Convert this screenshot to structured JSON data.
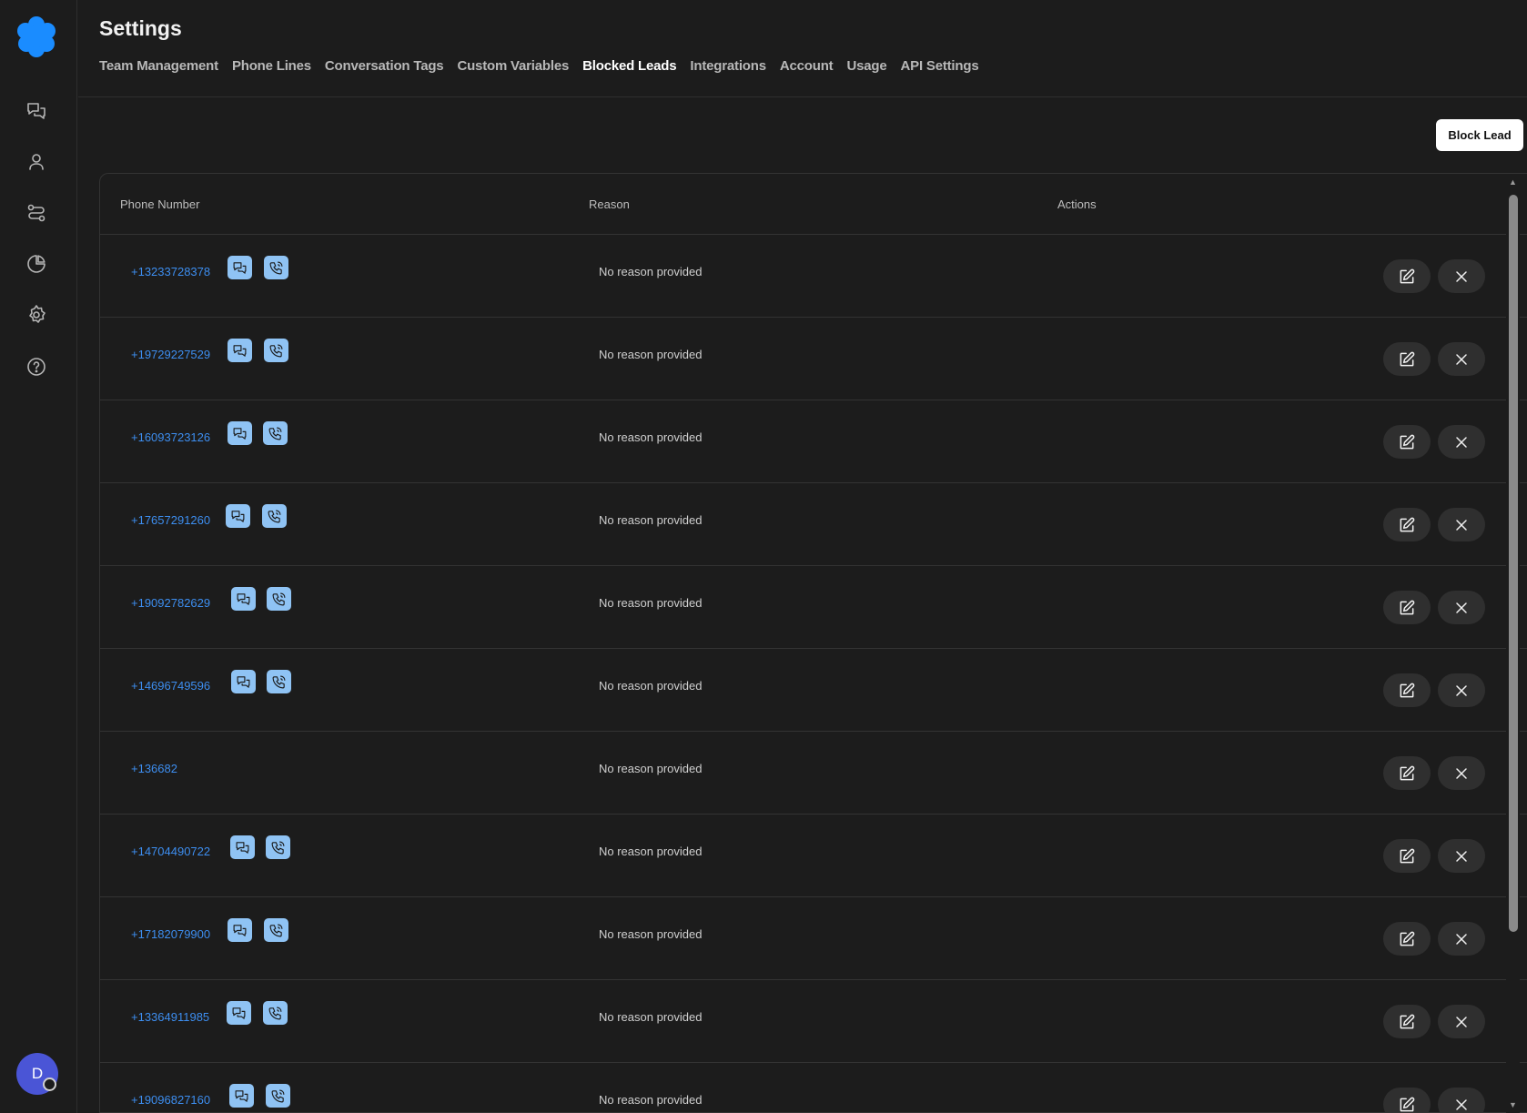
{
  "sidebar": {
    "nav": [
      {
        "name": "conversations-icon"
      },
      {
        "name": "contacts-icon"
      },
      {
        "name": "workflows-icon"
      },
      {
        "name": "analytics-icon"
      },
      {
        "name": "settings-icon"
      },
      {
        "name": "help-icon"
      }
    ],
    "avatar_initial": "D"
  },
  "header": {
    "title": "Settings",
    "tabs": [
      {
        "label": "Team Management",
        "active": false
      },
      {
        "label": "Phone Lines",
        "active": false
      },
      {
        "label": "Conversation Tags",
        "active": false
      },
      {
        "label": "Custom Variables",
        "active": false
      },
      {
        "label": "Blocked Leads",
        "active": true
      },
      {
        "label": "Integrations",
        "active": false
      },
      {
        "label": "Account",
        "active": false
      },
      {
        "label": "Usage",
        "active": false
      },
      {
        "label": "API Settings",
        "active": false
      }
    ]
  },
  "block_button_label": "Block Lead",
  "table": {
    "columns": [
      "Phone Number",
      "Reason",
      "Actions"
    ],
    "rows": [
      {
        "phone": "+13233728378",
        "reason": "No reason provided",
        "has_contact_icons": true
      },
      {
        "phone": "+19729227529",
        "reason": "No reason provided",
        "has_contact_icons": true
      },
      {
        "phone": "+16093723126",
        "reason": "No reason provided",
        "has_contact_icons": true
      },
      {
        "phone": "+17657291260",
        "reason": "No reason provided",
        "has_contact_icons": true
      },
      {
        "phone": "+19092782629",
        "reason": "No reason provided",
        "has_contact_icons": true
      },
      {
        "phone": "+14696749596",
        "reason": "No reason provided",
        "has_contact_icons": true
      },
      {
        "phone": "+136682",
        "reason": "No reason provided",
        "has_contact_icons": false
      },
      {
        "phone": "+14704490722",
        "reason": "No reason provided",
        "has_contact_icons": true
      },
      {
        "phone": "+17182079900",
        "reason": "No reason provided",
        "has_contact_icons": true
      },
      {
        "phone": "+13364911985",
        "reason": "No reason provided",
        "has_contact_icons": true
      },
      {
        "phone": "+19096827160",
        "reason": "No reason provided",
        "has_contact_icons": true
      }
    ]
  },
  "colors": {
    "background": "#1c1c1c",
    "accent_link": "#3d8ef0",
    "chip_bg": "#8fc3f4",
    "logo": "#1a8cff",
    "avatar": "#4a55d6"
  }
}
